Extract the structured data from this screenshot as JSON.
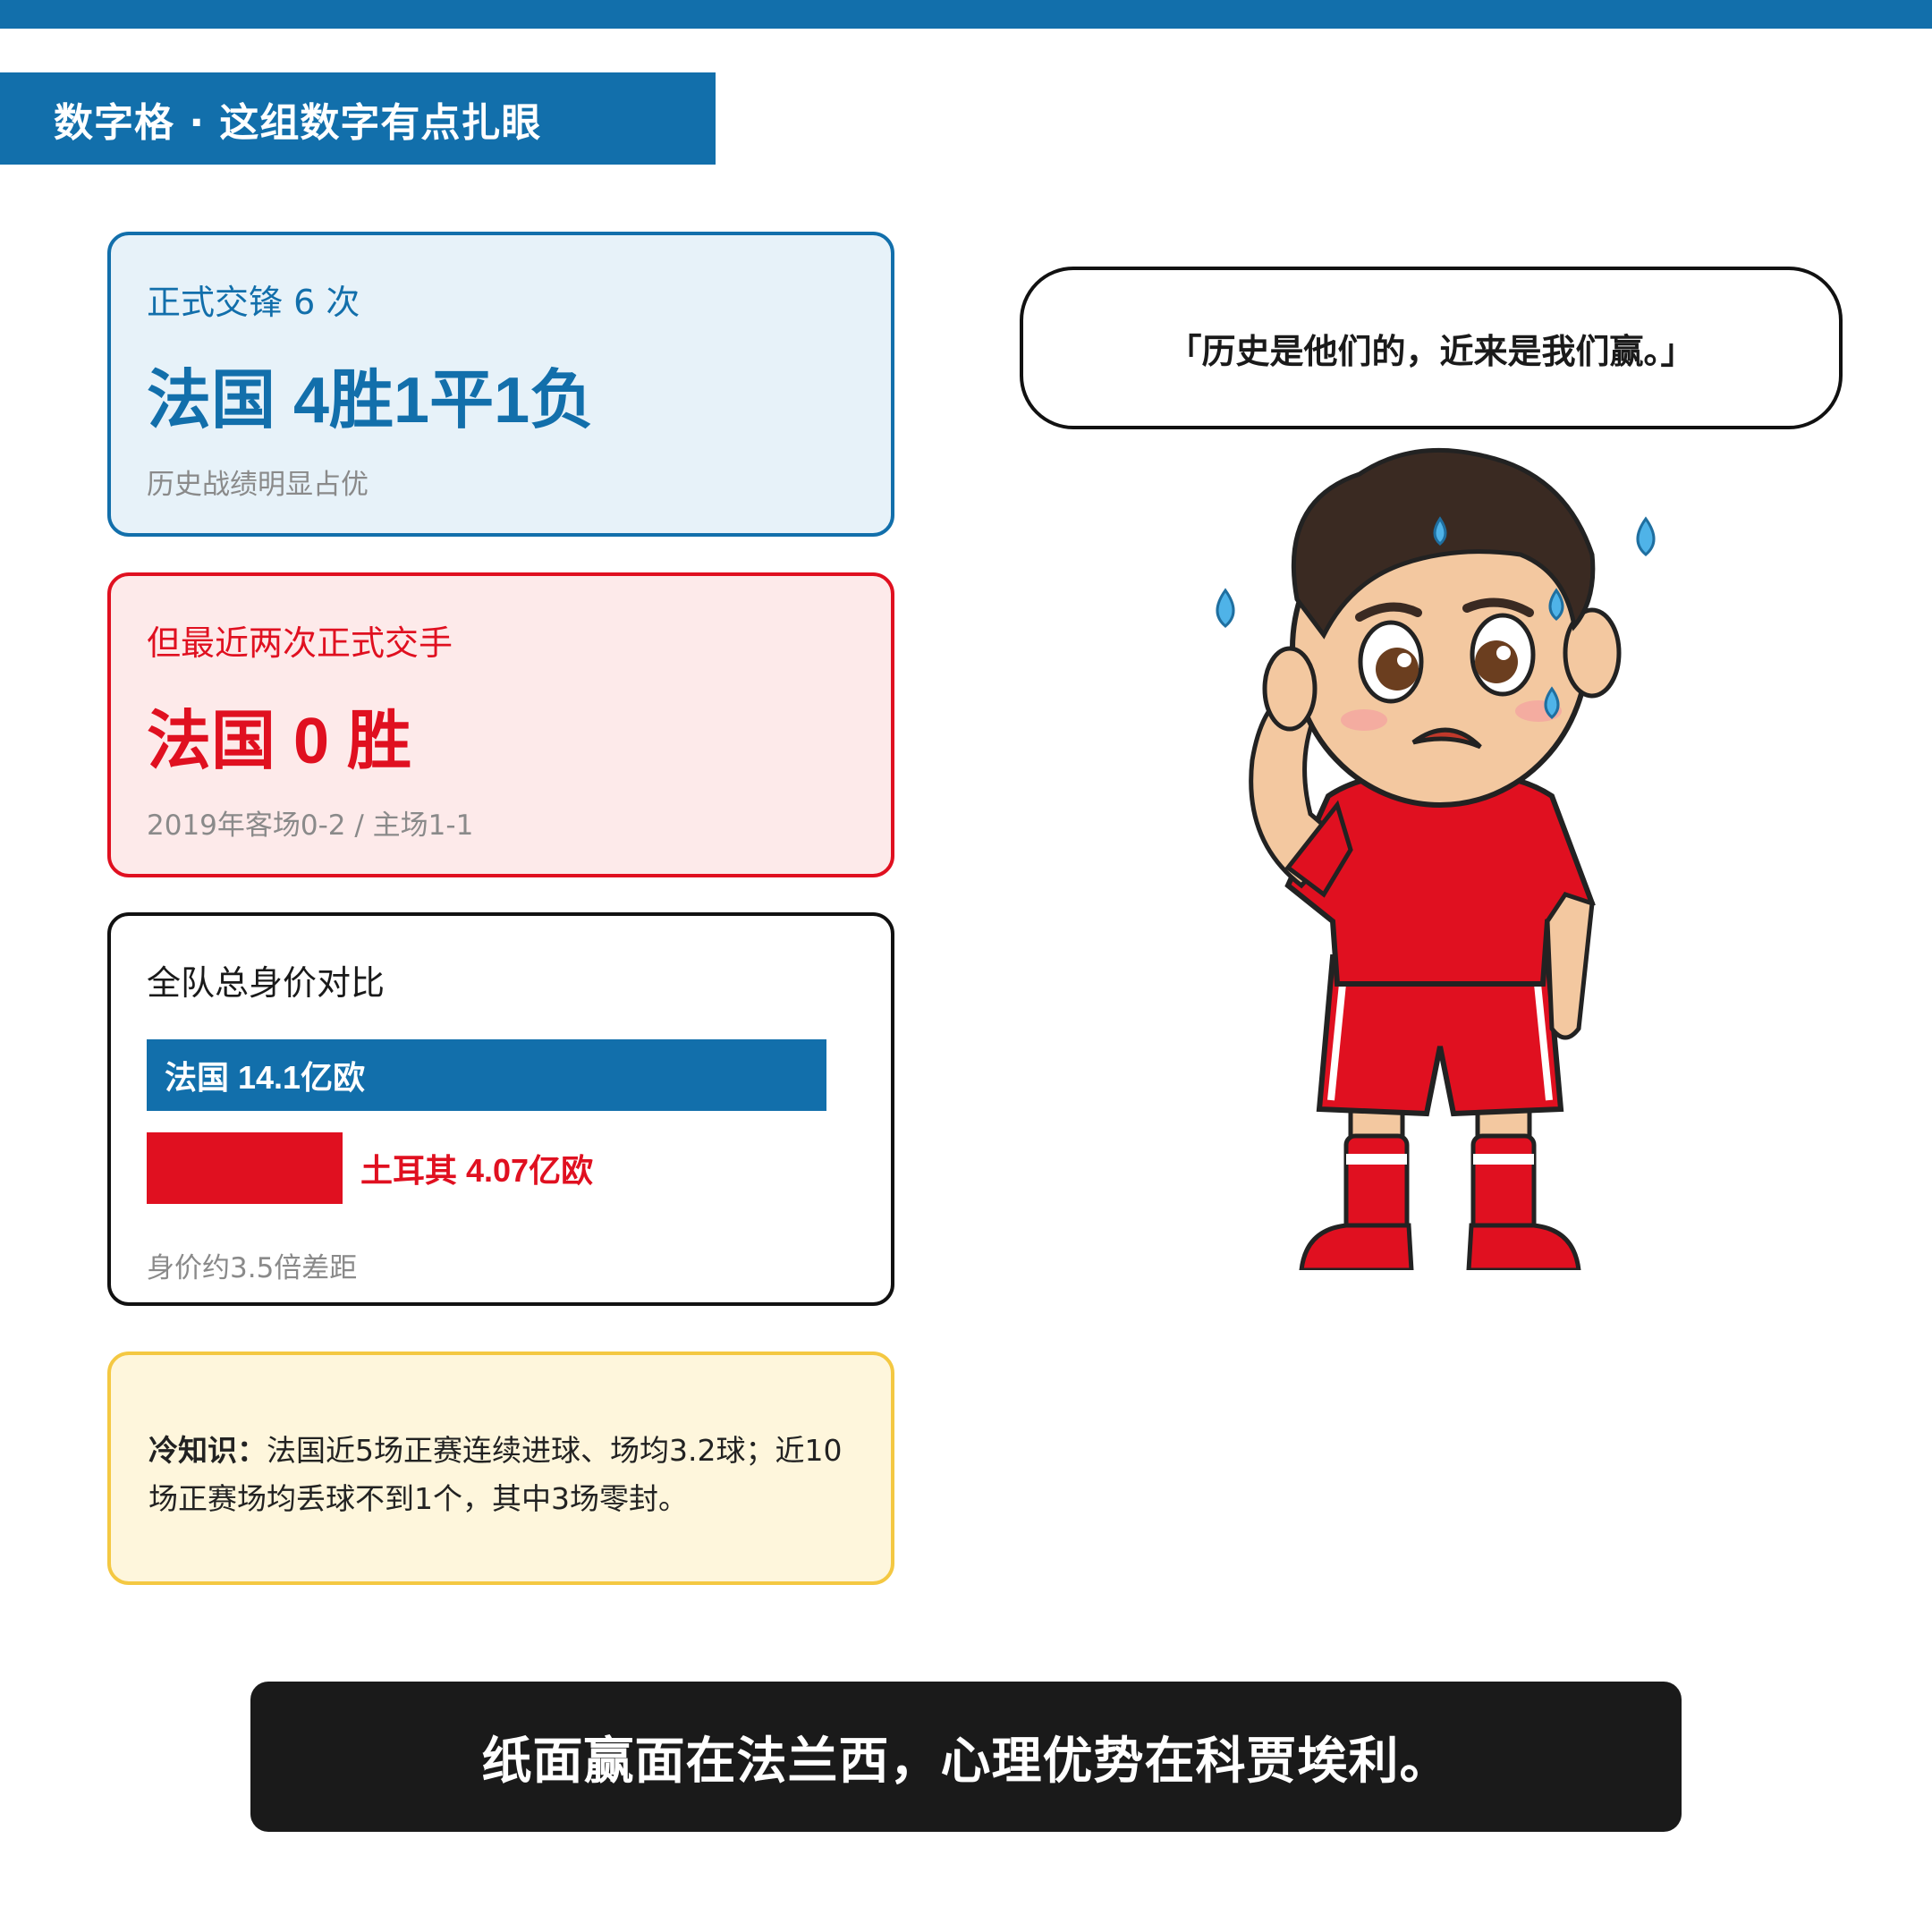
{
  "header": {
    "banner": "数字格 · 这组数字有点扎眼",
    "accent_color": "#126fab"
  },
  "cards": {
    "history": {
      "label": "正式交锋 6 次",
      "headline": "法国 4胜1平1负",
      "note": "历史战绩明显占优"
    },
    "recent": {
      "label": "但最近两次正式交手",
      "headline": "法国 0 胜",
      "note": "2019年客场0-2 / 主场1-1"
    },
    "value": {
      "label": "全队总身价对比",
      "france_bar": "法国 14.1亿欧",
      "turkey_bar": "土耳其 4.07亿欧",
      "france_value": 14.1,
      "turkey_value": 4.07,
      "note": "身价约3.5倍差距"
    },
    "tip": {
      "label": "冷知识：",
      "text": "法国近5场正赛连续进球、场均3.2球；近10场正赛场均丢球不到1个，其中3场零封。"
    }
  },
  "speech": {
    "quote": "「历史是他们的，近来是我们赢。」"
  },
  "conclusion": {
    "text": "纸面赢面在法兰西，心理优势在科贾埃利。"
  },
  "colors": {
    "france_blue": "#126fab",
    "turkey_red": "#e01020",
    "tip_border": "#f4c842",
    "dark": "#1a1a1a"
  },
  "illustration": {
    "icon": "worried-football-player-icon"
  }
}
